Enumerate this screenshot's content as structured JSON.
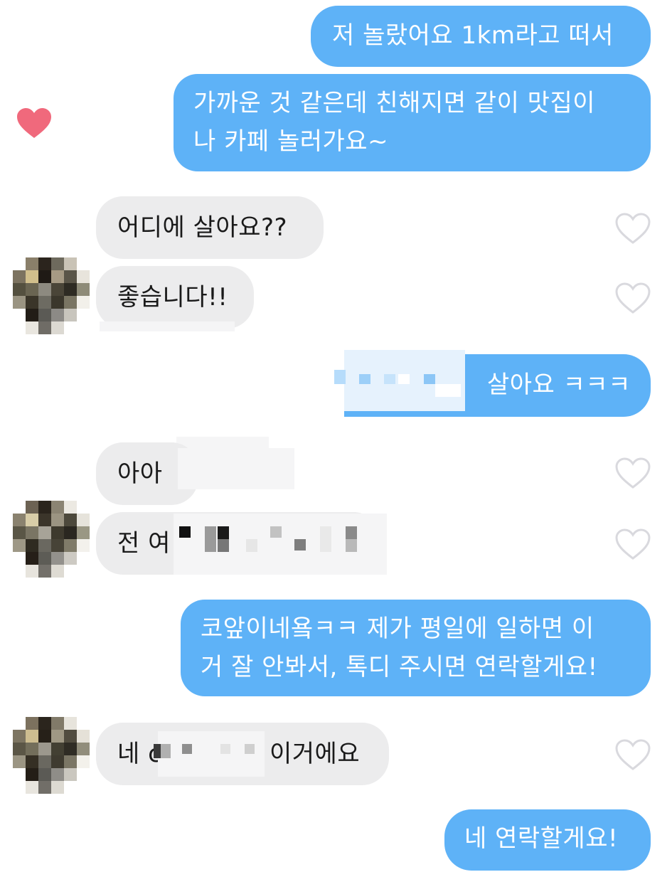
{
  "colors": {
    "outgoing_bubble": "#5eb2f7",
    "incoming_bubble": "#ececed",
    "liked_heart": "#f0697c",
    "unliked_heart": "#d9d9de"
  },
  "messages": [
    {
      "dir": "out",
      "text": "저 놀랐어요 1km라고 떠서"
    },
    {
      "dir": "out",
      "line1": "가까운 것 같은데 친해지면 같이 맛집이",
      "line2": "나 카페 놀러가요~",
      "liked": true
    },
    {
      "dir": "in",
      "text": "어디에 살아요??"
    },
    {
      "dir": "in",
      "text": "좋습니다!!"
    },
    {
      "dir": "out",
      "text": "살아요 ㅋㅋㅋ",
      "redacted": true
    },
    {
      "dir": "in",
      "text": "아아",
      "redacted": true
    },
    {
      "dir": "in",
      "text": "전 여",
      "redacted": true
    },
    {
      "dir": "out",
      "line1": "코앞이네욬ㅋㅋ 제가 평일에 일하면 이",
      "line2": "거 잘 안봐서, 톡디 주시면 연락할게요!"
    },
    {
      "dir": "in",
      "prefix": "네 c",
      "suffix": "이거에요",
      "redacted": true
    },
    {
      "dir": "out",
      "text": "네 연락할게요!"
    }
  ],
  "icons": {
    "like": "heart-outline-icon",
    "liked": "heart-filled-icon",
    "avatar": "avatar-pixelated"
  }
}
